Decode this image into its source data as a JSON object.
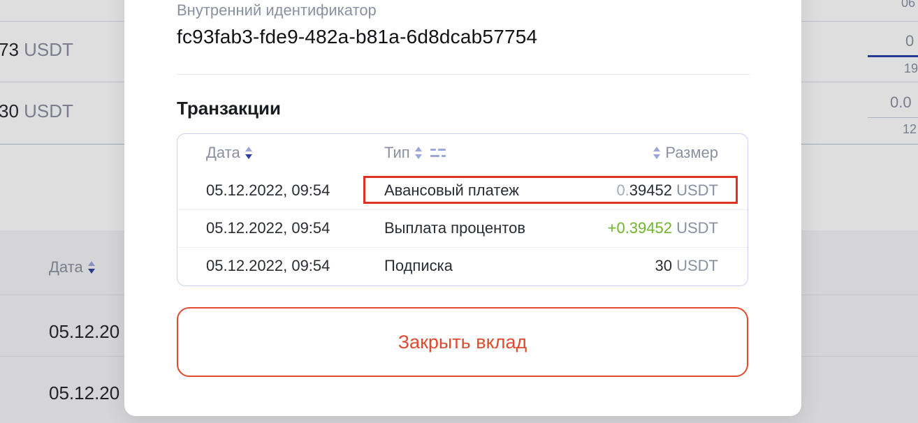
{
  "background": {
    "row1_amount": "73",
    "row2_amount": "30",
    "currency": "USDT",
    "date_header": "Дата",
    "row_dates": [
      "05.12.20",
      "05.12.20"
    ],
    "right_small": [
      "06",
      "0",
      "19",
      "0.0",
      "12"
    ]
  },
  "modal": {
    "field_label": "Внутренний идентификатор",
    "field_value": "fc93fab3-fde9-482a-b81a-6d8dcab57754",
    "section_title": "Транзакции",
    "table": {
      "headers": {
        "date": "Дата",
        "type": "Тип",
        "amount": "Размер"
      },
      "rows": [
        {
          "date": "05.12.2022, 09:54",
          "type": "Авансовый платеж",
          "amount_prefix": "0.",
          "amount_main": "39452",
          "currency": "USDT"
        },
        {
          "date": "05.12.2022, 09:54",
          "type": "Выплата процентов",
          "amount_prefix": "",
          "amount_main": "+0.39452",
          "currency": "USDT"
        },
        {
          "date": "05.12.2022, 09:54",
          "type": "Подписка",
          "amount_prefix": "",
          "amount_main": "30",
          "currency": "USDT"
        }
      ]
    },
    "close_button": "Закрыть вклад"
  },
  "colors": {
    "accent_red": "#e24a2d",
    "highlight_red": "#e03125",
    "positive_green": "#6fb52c",
    "sort_blue": "#2c3fa8",
    "table_border": "#c9d2ee"
  },
  "icons": [
    "sort-icon",
    "filter-icon"
  ]
}
